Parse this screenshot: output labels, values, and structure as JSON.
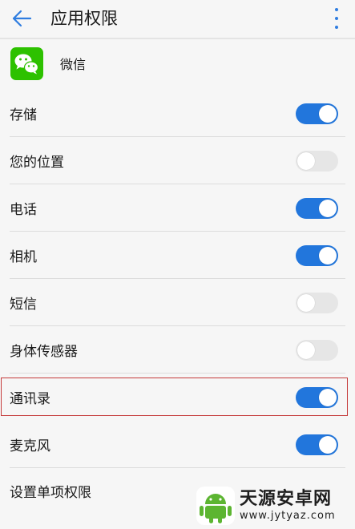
{
  "header": {
    "title": "应用权限",
    "back_icon": "arrow-left-icon",
    "more_icon": "more-vertical-icon",
    "accent_color": "#2f7de0"
  },
  "app": {
    "name": "微信",
    "icon": "wechat-icon",
    "icon_color": "#2dc100"
  },
  "permissions": [
    {
      "label": "存储",
      "enabled": true
    },
    {
      "label": "您的位置",
      "enabled": false
    },
    {
      "label": "电话",
      "enabled": true
    },
    {
      "label": "相机",
      "enabled": true
    },
    {
      "label": "短信",
      "enabled": false
    },
    {
      "label": "身体传感器",
      "enabled": false
    },
    {
      "label": "通讯录",
      "enabled": true,
      "highlighted": true
    },
    {
      "label": "麦克风",
      "enabled": true
    }
  ],
  "settings_link": {
    "label": "设置单项权限"
  },
  "toggle_colors": {
    "on": "#2276dc",
    "off": "#e6e6e6"
  },
  "highlight_color": "#c53a3a",
  "watermark": {
    "name": "天源安卓网",
    "url": "www.jytyaz.com",
    "logo_icon": "android-logo-icon"
  }
}
